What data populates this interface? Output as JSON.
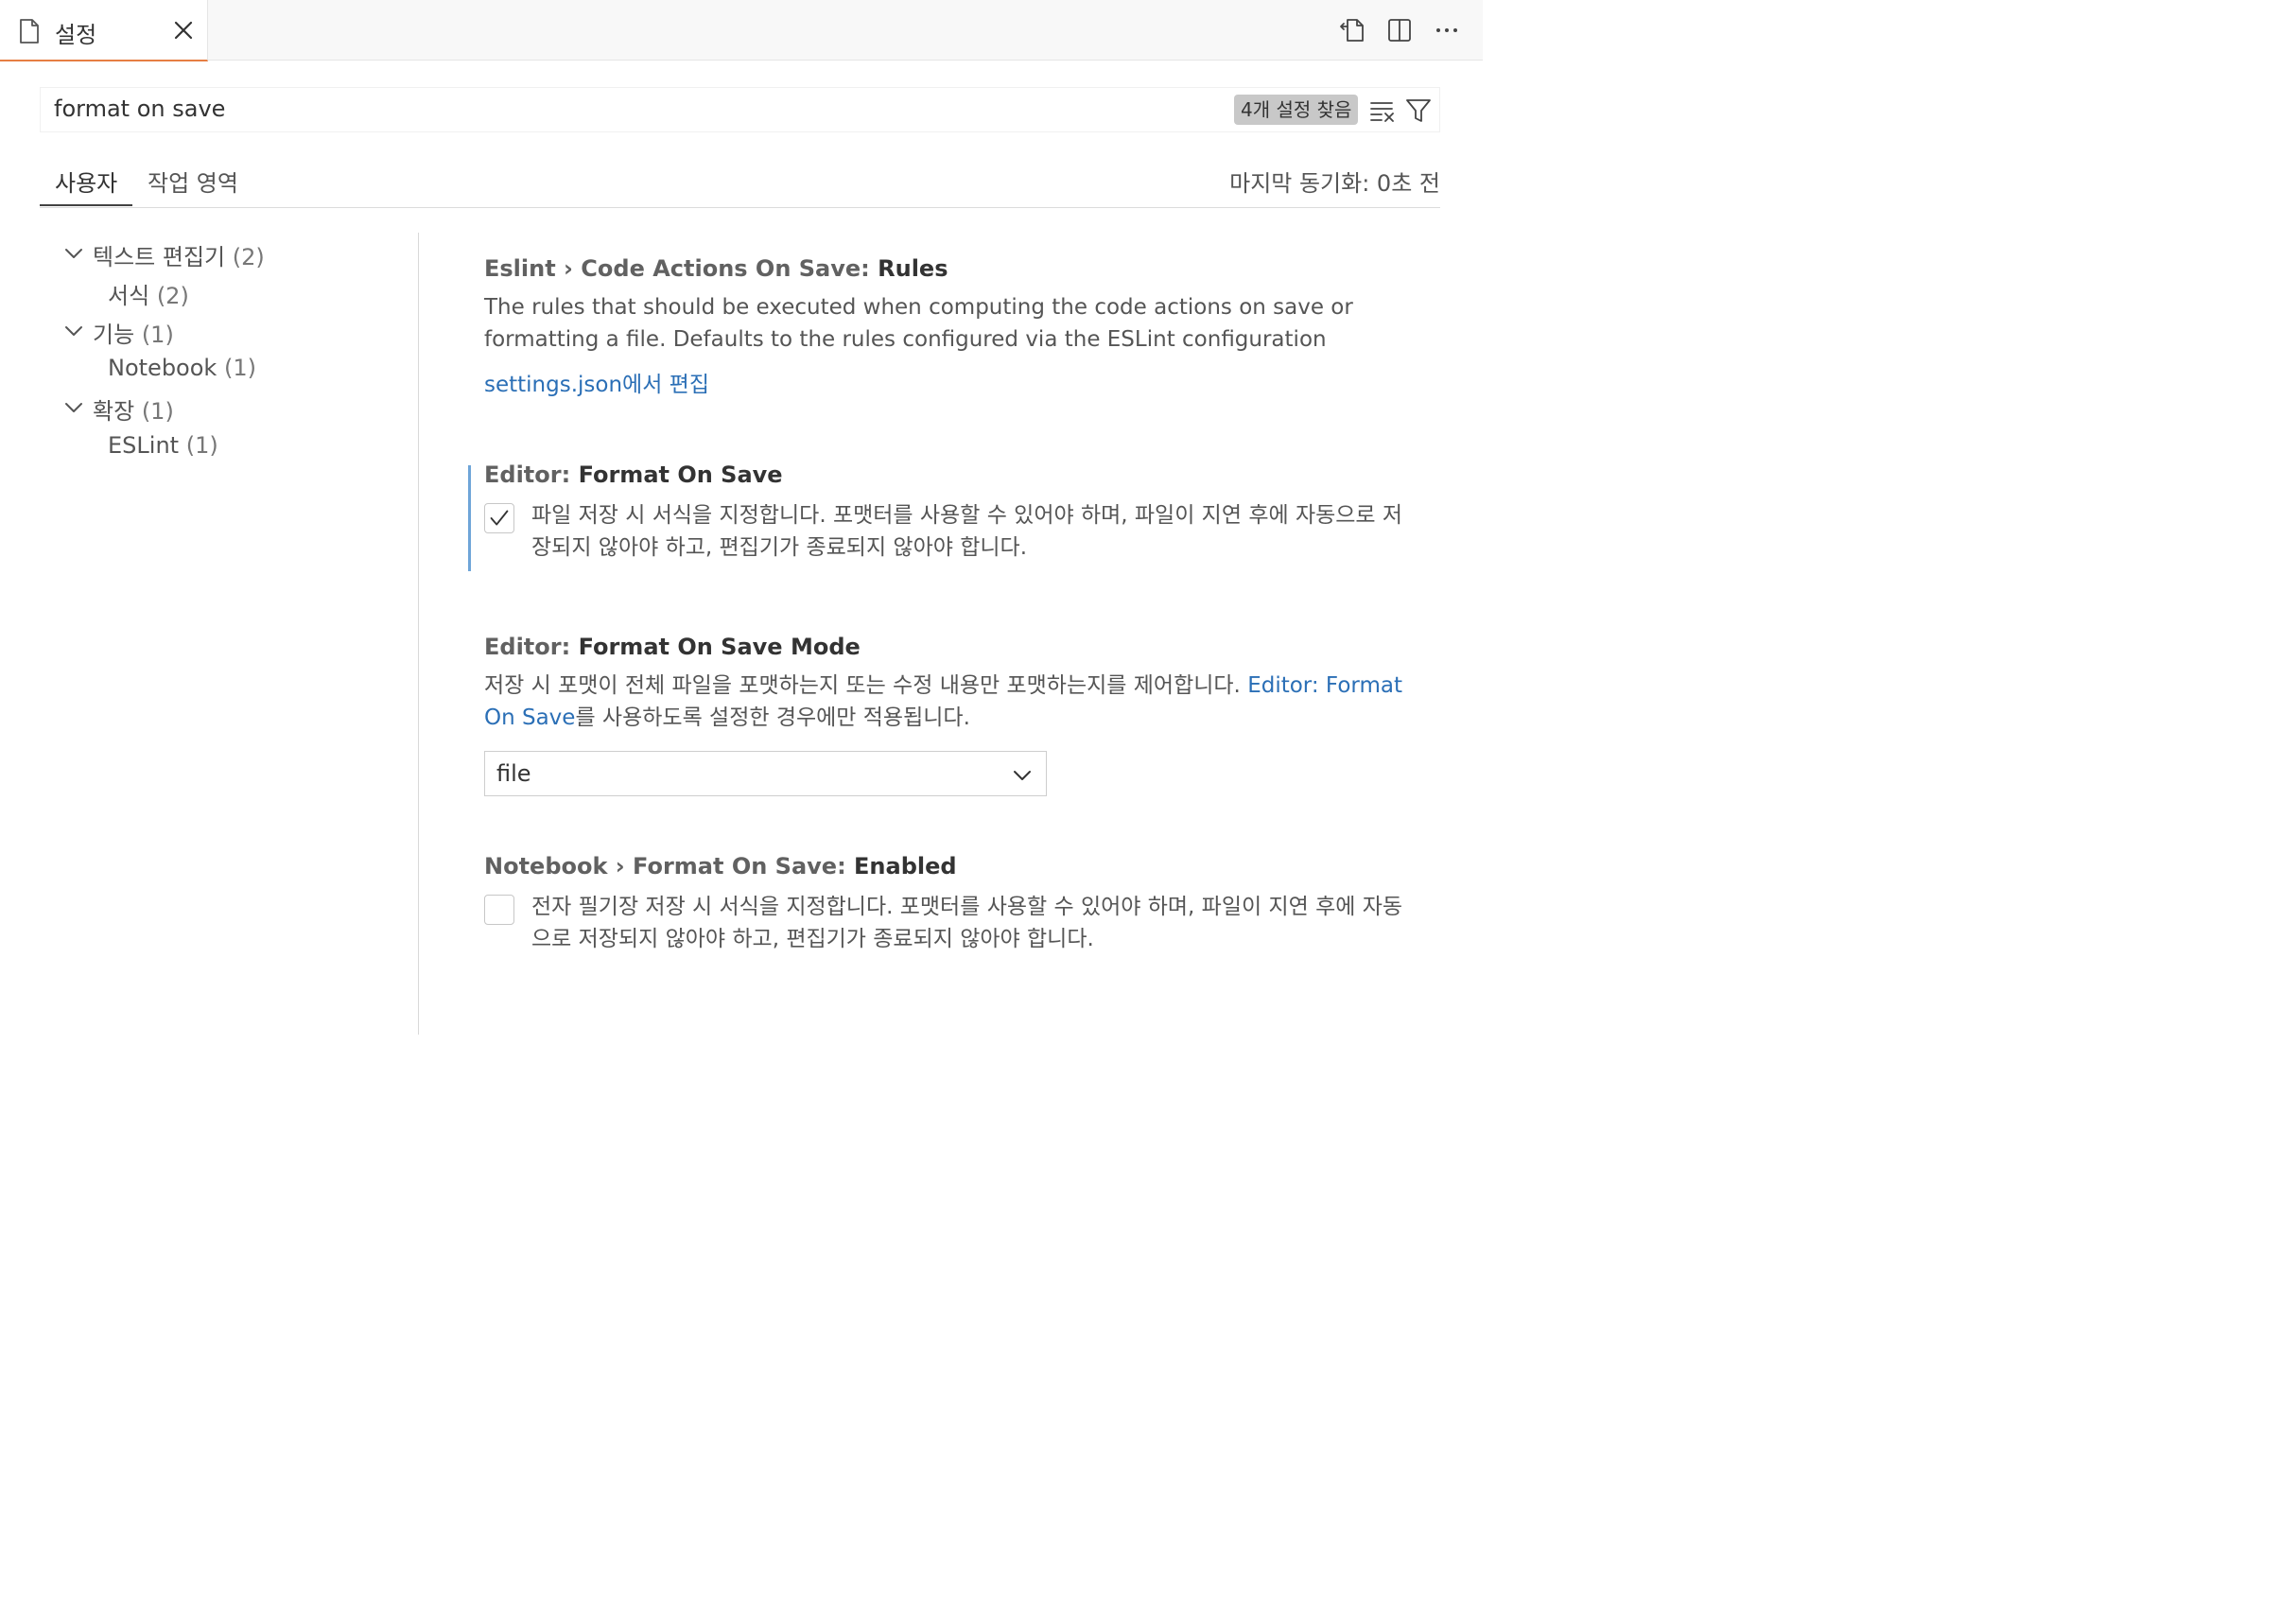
{
  "tab": {
    "title": "설정"
  },
  "search": {
    "query": "format on save",
    "result_count": "4개 설정 찾음"
  },
  "scope": {
    "user": "사용자",
    "workspace": "작업 영역",
    "last_sync": "마지막 동기화: 0초 전"
  },
  "toc": [
    {
      "label": "텍스트 편집기",
      "count": "(2)",
      "expanded": true
    },
    {
      "label": "서식",
      "count": "(2)"
    },
    {
      "label": "기능",
      "count": "(1)",
      "expanded": true
    },
    {
      "label": "Notebook",
      "count": "(1)"
    },
    {
      "label": "확장",
      "count": "(1)",
      "expanded": true
    },
    {
      "label": "ESLint",
      "count": "(1)"
    }
  ],
  "settings": [
    {
      "category": "Eslint › Code Actions On Save: ",
      "key": "Rules",
      "description": "The rules that should be executed when computing the code actions on save or formatting a file. Defaults to the rules configured via the ESLint configuration",
      "link": "settings.json에서 편집"
    },
    {
      "category": "Editor: ",
      "key": "Format On Save",
      "checked": true,
      "description": "파일 저장 시 서식을 지정합니다. 포맷터를 사용할 수 있어야 하며, 파일이 지연 후에 자동으로 저장되지 않아야 하고, 편집기가 종료되지 않아야 합니다."
    },
    {
      "category": "Editor: ",
      "key": "Format On Save Mode",
      "description_before": "저장 시 포맷이 전체 파일을 포맷하는지 또는 수정 내용만 포맷하는지를 제어합니다. ",
      "description_link": "Editor: Format On Save",
      "description_after": "를 사용하도록 설정한 경우에만 적용됩니다.",
      "value": "file"
    },
    {
      "category": "Notebook › Format On Save: ",
      "key": "Enabled",
      "checked": false,
      "description": "전자 필기장 저장 시 서식을 지정합니다. 포맷터를 사용할 수 있어야 하며, 파일이 지연 후에 자동으로 저장되지 않아야 하고, 편집기가 종료되지 않아야 합니다."
    }
  ]
}
